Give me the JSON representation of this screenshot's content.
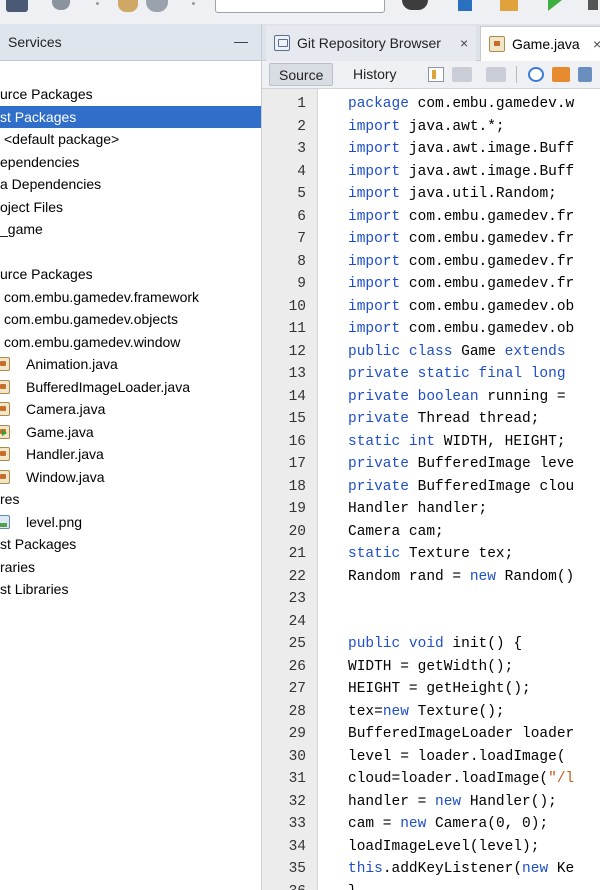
{
  "toolbar": {
    "icons": [
      "save-all-icon",
      "gear-icon",
      "hammer-icon",
      "clean-build-icon",
      "config-select",
      "build-icon",
      "clean-icon",
      "debug-icon",
      "run-icon",
      "more-icon"
    ]
  },
  "left_panel": {
    "tab_label": "Services",
    "minimize_symbol": "—",
    "tree": [
      {
        "text": "urce Packages",
        "icon": null,
        "indent": 0,
        "selected": false
      },
      {
        "text": "st Packages",
        "icon": null,
        "indent": 0,
        "selected": true
      },
      {
        "text": "<default package>",
        "icon": null,
        "indent": 1,
        "selected": false
      },
      {
        "text": "ependencies",
        "icon": null,
        "indent": 0,
        "selected": false
      },
      {
        "text": "a Dependencies",
        "icon": null,
        "indent": 0,
        "selected": false
      },
      {
        "text": "oject Files",
        "icon": null,
        "indent": 0,
        "selected": false
      },
      {
        "text": "_game",
        "icon": null,
        "indent": 0,
        "selected": false
      },
      {
        "text": "",
        "icon": null,
        "indent": 0,
        "selected": false
      },
      {
        "text": "urce Packages",
        "icon": null,
        "indent": 0,
        "selected": false
      },
      {
        "text": "com.embu.gamedev.framework",
        "icon": null,
        "indent": 1,
        "selected": false
      },
      {
        "text": "com.embu.gamedev.objects",
        "icon": null,
        "indent": 1,
        "selected": false
      },
      {
        "text": "com.embu.gamedev.window",
        "icon": null,
        "indent": 1,
        "selected": false
      },
      {
        "text": "Animation.java",
        "icon": "java",
        "indent": 2,
        "selected": false
      },
      {
        "text": "BufferedImageLoader.java",
        "icon": "java",
        "indent": 2,
        "selected": false
      },
      {
        "text": "Camera.java",
        "icon": "java",
        "indent": 2,
        "selected": false
      },
      {
        "text": "Game.java",
        "icon": "java-main",
        "indent": 2,
        "selected": false
      },
      {
        "text": "Handler.java",
        "icon": "java",
        "indent": 2,
        "selected": false
      },
      {
        "text": "Window.java",
        "icon": "java",
        "indent": 2,
        "selected": false
      },
      {
        "text": "res",
        "icon": null,
        "indent": 0,
        "selected": false
      },
      {
        "text": "level.png",
        "icon": "image",
        "indent": 2,
        "selected": false
      },
      {
        "text": "st Packages",
        "icon": null,
        "indent": 0,
        "selected": false
      },
      {
        "text": "raries",
        "icon": null,
        "indent": 0,
        "selected": false
      },
      {
        "text": "st Libraries",
        "icon": null,
        "indent": 0,
        "selected": false
      }
    ]
  },
  "editor": {
    "tabs": [
      {
        "label": "Git Repository Browser",
        "close": "×",
        "active": false
      },
      {
        "label": "Game.java",
        "close": "×",
        "active": true
      }
    ],
    "subbar": {
      "source_label": "Source",
      "history_label": "History"
    },
    "lines": [
      {
        "n": "1",
        "parts": [
          {
            "t": "package",
            "k": "kw"
          },
          {
            "t": " com.embu.gamedev.w",
            "k": ""
          }
        ]
      },
      {
        "n": "2",
        "parts": [
          {
            "t": "import",
            "k": "kw"
          },
          {
            "t": " java.awt.*;",
            "k": ""
          }
        ]
      },
      {
        "n": "3",
        "parts": [
          {
            "t": "import",
            "k": "kw"
          },
          {
            "t": " java.awt.image.Buff",
            "k": ""
          }
        ]
      },
      {
        "n": "4",
        "parts": [
          {
            "t": "import",
            "k": "kw"
          },
          {
            "t": " java.awt.image.Buff",
            "k": ""
          }
        ]
      },
      {
        "n": "5",
        "parts": [
          {
            "t": "import",
            "k": "kw"
          },
          {
            "t": " java.util.Random;",
            "k": ""
          }
        ]
      },
      {
        "n": "6",
        "parts": [
          {
            "t": "import",
            "k": "kw"
          },
          {
            "t": " com.embu.gamedev.fr",
            "k": ""
          }
        ]
      },
      {
        "n": "7",
        "parts": [
          {
            "t": "import",
            "k": "kw"
          },
          {
            "t": " com.embu.gamedev.fr",
            "k": ""
          }
        ]
      },
      {
        "n": "8",
        "parts": [
          {
            "t": "import",
            "k": "kw"
          },
          {
            "t": " com.embu.gamedev.fr",
            "k": ""
          }
        ]
      },
      {
        "n": "9",
        "parts": [
          {
            "t": "import",
            "k": "kw"
          },
          {
            "t": " com.embu.gamedev.fr",
            "k": ""
          }
        ]
      },
      {
        "n": "10",
        "parts": [
          {
            "t": "import",
            "k": "kw"
          },
          {
            "t": " com.embu.gamedev.ob",
            "k": ""
          }
        ]
      },
      {
        "n": "11",
        "parts": [
          {
            "t": "import",
            "k": "kw"
          },
          {
            "t": " com.embu.gamedev.ob",
            "k": ""
          }
        ]
      },
      {
        "n": "12",
        "parts": [
          {
            "t": "public class",
            "k": "kw"
          },
          {
            "t": " Game ",
            "k": ""
          },
          {
            "t": "extends",
            "k": "kw"
          }
        ]
      },
      {
        "n": "13",
        "parts": [
          {
            "t": "private static final long",
            "k": "kw"
          }
        ]
      },
      {
        "n": "14",
        "parts": [
          {
            "t": "private boolean",
            "k": "kw"
          },
          {
            "t": " running =",
            "k": ""
          }
        ]
      },
      {
        "n": "15",
        "parts": [
          {
            "t": "private",
            "k": "kw"
          },
          {
            "t": " Thread thread;",
            "k": ""
          }
        ]
      },
      {
        "n": "16",
        "parts": [
          {
            "t": "static int",
            "k": "kw"
          },
          {
            "t": " WIDTH, HEIGHT;",
            "k": ""
          }
        ]
      },
      {
        "n": "17",
        "parts": [
          {
            "t": "private",
            "k": "kw"
          },
          {
            "t": " BufferedImage leve",
            "k": ""
          }
        ]
      },
      {
        "n": "18",
        "parts": [
          {
            "t": "private",
            "k": "kw"
          },
          {
            "t": " BufferedImage clou",
            "k": ""
          }
        ]
      },
      {
        "n": "19",
        "parts": [
          {
            "t": "Handler handler;",
            "k": ""
          }
        ]
      },
      {
        "n": "20",
        "parts": [
          {
            "t": "Camera cam;",
            "k": ""
          }
        ]
      },
      {
        "n": "21",
        "parts": [
          {
            "t": "static",
            "k": "kw"
          },
          {
            "t": " Texture tex;",
            "k": ""
          }
        ]
      },
      {
        "n": "22",
        "parts": [
          {
            "t": "Random rand = ",
            "k": ""
          },
          {
            "t": "new",
            "k": "kw"
          },
          {
            "t": " Random()",
            "k": ""
          }
        ]
      },
      {
        "n": "23",
        "parts": []
      },
      {
        "n": "24",
        "parts": []
      },
      {
        "n": "25",
        "parts": [
          {
            "t": "public void",
            "k": "kw"
          },
          {
            "t": " init() {",
            "k": ""
          }
        ]
      },
      {
        "n": "26",
        "parts": [
          {
            "t": "WIDTH = getWidth();",
            "k": ""
          }
        ]
      },
      {
        "n": "27",
        "parts": [
          {
            "t": "HEIGHT = getHeight();",
            "k": ""
          }
        ]
      },
      {
        "n": "28",
        "parts": [
          {
            "t": "tex=",
            "k": ""
          },
          {
            "t": "new",
            "k": "kw"
          },
          {
            "t": " Texture();",
            "k": ""
          }
        ]
      },
      {
        "n": "29",
        "parts": [
          {
            "t": "BufferedImageLoader loader",
            "k": ""
          }
        ]
      },
      {
        "n": "30",
        "parts": [
          {
            "t": "level = loader.loadImage(",
            "k": ""
          }
        ]
      },
      {
        "n": "31",
        "parts": [
          {
            "t": "cloud=loader.loadImage(",
            "k": ""
          },
          {
            "t": "\"/l",
            "k": "str"
          }
        ]
      },
      {
        "n": "32",
        "parts": [
          {
            "t": "handler = ",
            "k": ""
          },
          {
            "t": "new",
            "k": "kw"
          },
          {
            "t": " Handler();",
            "k": ""
          }
        ]
      },
      {
        "n": "33",
        "parts": [
          {
            "t": "cam = ",
            "k": ""
          },
          {
            "t": "new",
            "k": "kw"
          },
          {
            "t": " Camera(0, 0);",
            "k": ""
          }
        ]
      },
      {
        "n": "34",
        "parts": [
          {
            "t": "loadImageLevel(level);",
            "k": ""
          }
        ]
      },
      {
        "n": "35",
        "parts": [
          {
            "t": "this",
            "k": "kw"
          },
          {
            "t": ".addKeyListener(",
            "k": ""
          },
          {
            "t": "new",
            "k": "kw"
          },
          {
            "t": " Ke",
            "k": ""
          }
        ]
      },
      {
        "n": "36",
        "parts": [
          {
            "t": "}",
            "k": ""
          }
        ]
      }
    ]
  }
}
